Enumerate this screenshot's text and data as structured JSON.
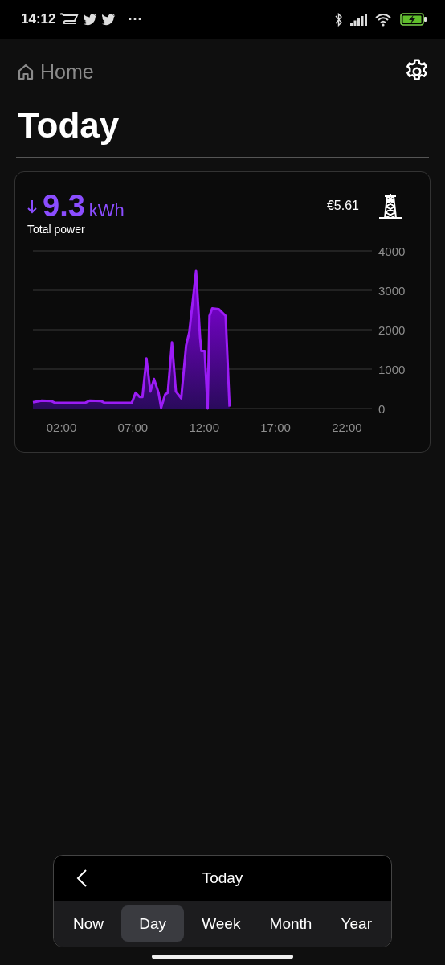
{
  "status_bar": {
    "time": "14:12",
    "more": "···"
  },
  "header": {
    "back_label": "Home",
    "title": "Today"
  },
  "summary": {
    "value": "9.3",
    "unit": "kWh",
    "label": "Total power",
    "cost": "€5.61"
  },
  "chart": {
    "chart_data": {
      "type": "area",
      "x": [
        0,
        0.62,
        1.28,
        1.56,
        3.63,
        4.0,
        4.76,
        5.04,
        6.92,
        7.2,
        7.48,
        7.67,
        7.95,
        8.23,
        8.48,
        8.8,
        8.98,
        9.27,
        9.45,
        9.74,
        10.02,
        10.39,
        10.73,
        10.96,
        11.43,
        11.71,
        11.8,
        12.03,
        12.24,
        12.37,
        12.56,
        13.03,
        13.5,
        13.78
      ],
      "series": [
        {
          "color": "#9b1cf5",
          "values": [
            160,
            200,
            190,
            140,
            140,
            200,
            190,
            140,
            140,
            400,
            290,
            290,
            1270,
            430,
            750,
            400,
            20,
            360,
            400,
            1680,
            430,
            260,
            1600,
            1940,
            3490,
            1800,
            1460,
            1460,
            0,
            2350,
            2540,
            2520,
            2350,
            50
          ]
        }
      ],
      "grid": true,
      "xlim": [
        0,
        23.75
      ],
      "ylim": [
        0,
        4000
      ],
      "xticks": [
        {
          "value": 2,
          "label": "02:00"
        },
        {
          "value": 7,
          "label": "07:00"
        },
        {
          "value": 12,
          "label": "12:00"
        },
        {
          "value": 17,
          "label": "17:00"
        },
        {
          "value": 22,
          "label": "22:00"
        }
      ],
      "yticks": [
        0,
        1000,
        2000,
        3000,
        4000
      ]
    }
  },
  "period_nav": {
    "title": "Today",
    "tabs": [
      {
        "label": "Now",
        "selected": false
      },
      {
        "label": "Day",
        "selected": true
      },
      {
        "label": "Week",
        "selected": false
      },
      {
        "label": "Month",
        "selected": false
      },
      {
        "label": "Year",
        "selected": false
      }
    ]
  }
}
